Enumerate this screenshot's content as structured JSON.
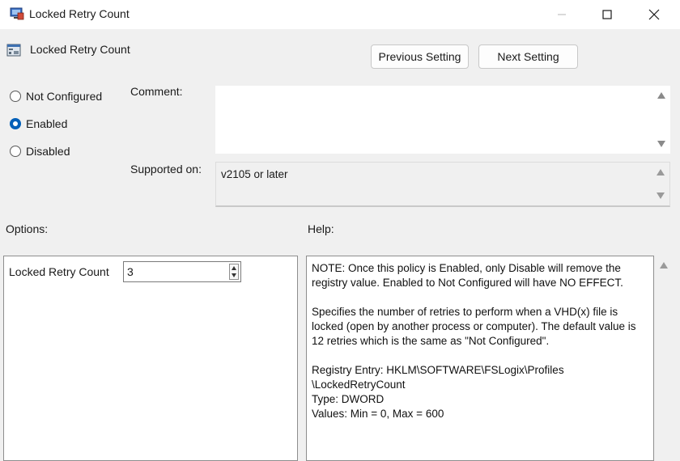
{
  "window": {
    "title": "Locked Retry Count",
    "minimize_icon": "minimize-icon",
    "maximize_icon": "maximize-icon",
    "close_icon": "close-icon"
  },
  "header": {
    "policy_title": "Locked Retry Count",
    "prev_label": "Previous Setting",
    "next_label": "Next Setting"
  },
  "state": {
    "options": [
      {
        "label": "Not Configured",
        "checked": false
      },
      {
        "label": "Enabled",
        "checked": true
      },
      {
        "label": "Disabled",
        "checked": false
      }
    ]
  },
  "comment": {
    "label": "Comment:",
    "value": ""
  },
  "supported": {
    "label": "Supported on:",
    "value": "v2105 or later"
  },
  "options_section": {
    "heading": "Options:",
    "field_label": "Locked Retry Count",
    "field_value": "3"
  },
  "help_section": {
    "heading": "Help:",
    "paragraphs": [
      "NOTE:  Once this policy is Enabled, only Disable will remove the registry value. Enabled to Not Configured will have NO EFFECT.",
      "Specifies the number of retries to perform when a VHD(x) file is locked (open by another process or computer). The default value is 12 retries which is the same as \"Not Configured\".",
      "Registry Entry:  HKLM\\SOFTWARE\\FSLogix\\Profiles",
      "\\LockedRetryCount",
      "Type:  DWORD",
      "Values:  Min = 0, Max = 600"
    ]
  },
  "colors": {
    "accent": "#005fb8",
    "window_bg": "#f0f0f0"
  }
}
